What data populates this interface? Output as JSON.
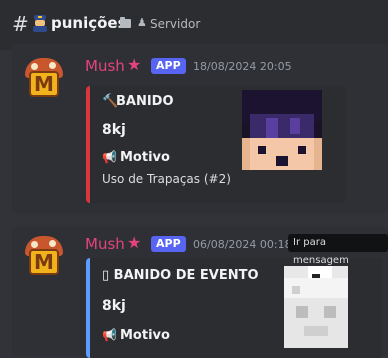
{
  "channel": {
    "hash": "#",
    "emoji_icon": "police-officer-icon",
    "name": "punições",
    "folder_icon": "folder-icon",
    "person_icon": "person-icon",
    "server_label": "Servidor"
  },
  "colors": {
    "accent_author": "#e5437c",
    "app_badge": "#5865f2",
    "embed1_bar": "#da373c",
    "embed2_bar": "#5c9dff"
  },
  "messages": [
    {
      "author": "Mush",
      "star": "★",
      "badge": "APP",
      "timestamp": "18/08/2024 20:05",
      "embed": {
        "title_icon": "hammer-icon",
        "title": "BANIDO",
        "player": "8kj",
        "field_icon": "megaphone-icon",
        "field_label": "Motivo",
        "field_value": "Uso de Trapaças (#2)"
      }
    },
    {
      "author": "Mush",
      "star": "★",
      "badge": "APP",
      "timestamp": "06/08/2024 00:18",
      "embed": {
        "title_icon": "placeholder-glyph-icon",
        "title": "▯ BANIDO DE EVENTO",
        "player": "8kj",
        "field_icon": "megaphone-icon",
        "field_label": "Motivo"
      }
    }
  ],
  "tooltip": "Ir para mensagem"
}
